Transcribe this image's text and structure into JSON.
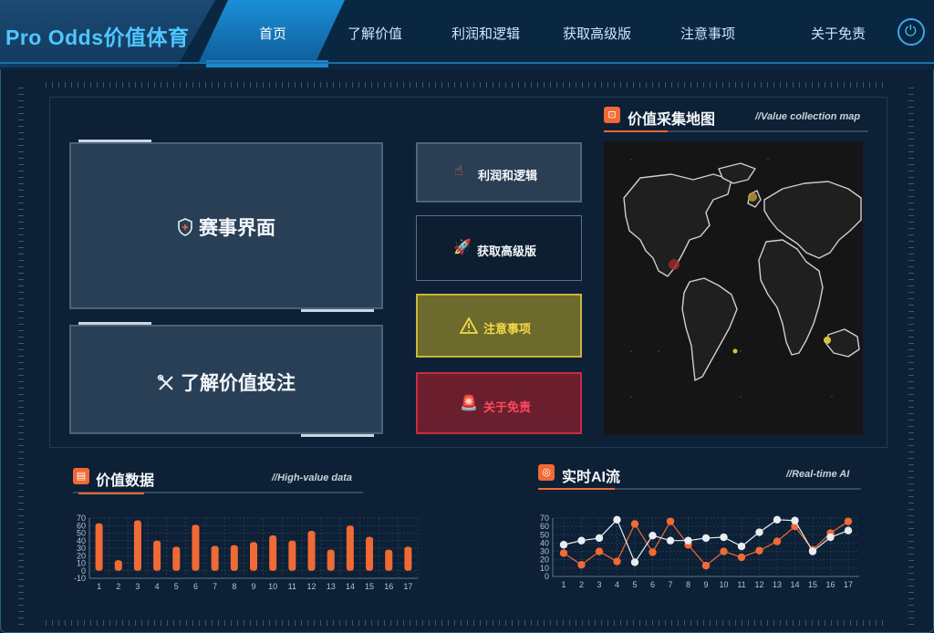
{
  "header": {
    "brand": "Pro Odds价值体育",
    "nav": [
      "首页",
      "了解价值",
      "利润和逻辑",
      "获取高级版",
      "注意事项",
      "关于免责"
    ],
    "active": "首页"
  },
  "panels": {
    "match": "赛事界面",
    "learn": "了解价值投注"
  },
  "buttons": {
    "profit": "利润和逻辑",
    "premium": "获取高级版",
    "notes": "注意事项",
    "disclaimer": "关于免责"
  },
  "map": {
    "title": "价值采集地图",
    "subtitle": "//Value collection map"
  },
  "value_data": {
    "title": "价值数据",
    "subtitle": "//High-value data"
  },
  "ai_flow": {
    "title": "实时AI流",
    "subtitle": "//Real-time AI"
  },
  "colors": {
    "accent": "#f06a35",
    "brand": "#4ec6ff",
    "nav_active": "#1a8fd6",
    "notes": "#d8c23a",
    "disclaimer": "#e0344a"
  },
  "chart_data": [
    {
      "type": "bar",
      "categories": [
        "1",
        "2",
        "3",
        "4",
        "5",
        "6",
        "7",
        "8",
        "9",
        "10",
        "11",
        "12",
        "13",
        "14",
        "15",
        "16",
        "17"
      ],
      "values": [
        63,
        14,
        67,
        40,
        32,
        61,
        33,
        34,
        38,
        47,
        40,
        53,
        28,
        60,
        45,
        28,
        32
      ],
      "ylim": [
        -10,
        70
      ],
      "yticks": [
        -10,
        0,
        10,
        20,
        30,
        40,
        50,
        60,
        70
      ],
      "grid": true
    },
    {
      "type": "line",
      "categories": [
        "1",
        "2",
        "3",
        "4",
        "5",
        "6",
        "7",
        "8",
        "9",
        "10",
        "11",
        "12",
        "13",
        "14",
        "15",
        "16",
        "17"
      ],
      "series": [
        {
          "color": "#f06a35",
          "values": [
            28,
            14,
            30,
            18,
            63,
            29,
            66,
            38,
            13,
            30,
            23,
            31,
            42,
            60,
            32,
            52,
            66
          ]
        },
        {
          "color": "#e9edf2",
          "values": [
            38,
            43,
            46,
            68,
            17,
            49,
            43,
            43,
            46,
            47,
            36,
            53,
            68,
            67,
            30,
            47,
            55
          ]
        }
      ],
      "ylim": [
        0,
        70
      ],
      "yticks": [
        0,
        10,
        20,
        30,
        40,
        50,
        60,
        70
      ],
      "grid": true
    }
  ]
}
